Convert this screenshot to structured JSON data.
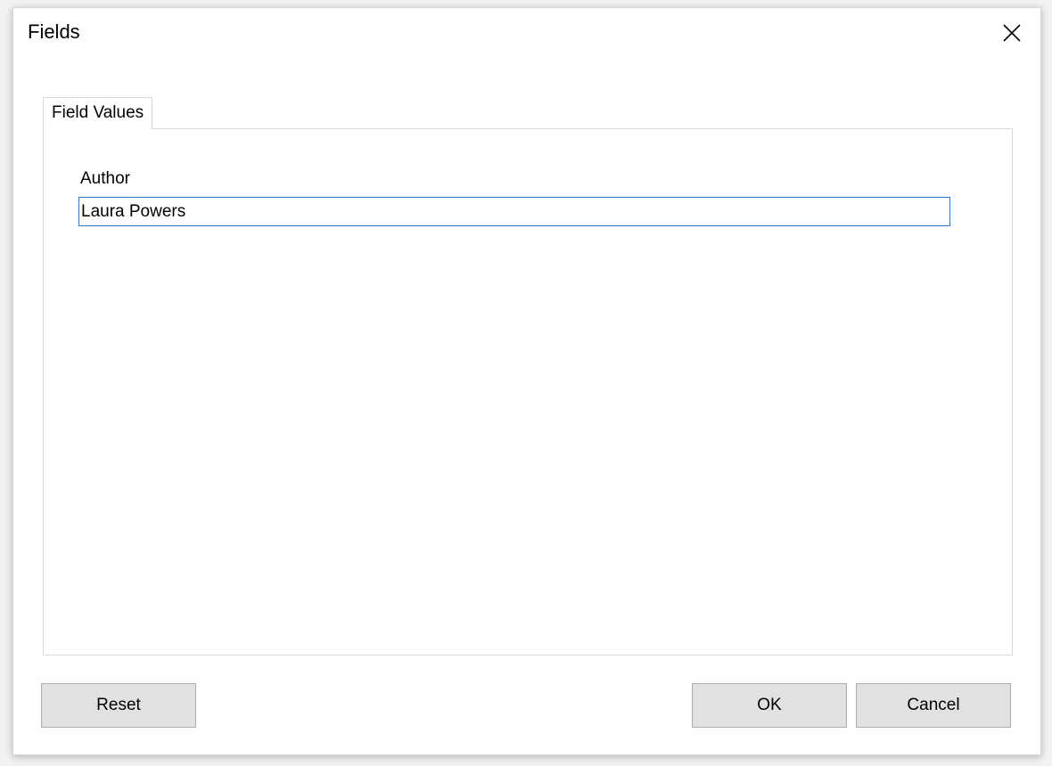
{
  "window": {
    "title": "Fields",
    "close_icon": "close-icon"
  },
  "tabs": [
    {
      "label": "Field Values",
      "active": true
    }
  ],
  "fields": [
    {
      "label": "Author",
      "value": "Laura Powers",
      "focused": true
    }
  ],
  "buttons": {
    "reset_label": "Reset",
    "ok_label": "OK",
    "cancel_label": "Cancel"
  },
  "colors": {
    "focus_border": "#2a7ac4",
    "button_face": "#e1e1e1"
  }
}
